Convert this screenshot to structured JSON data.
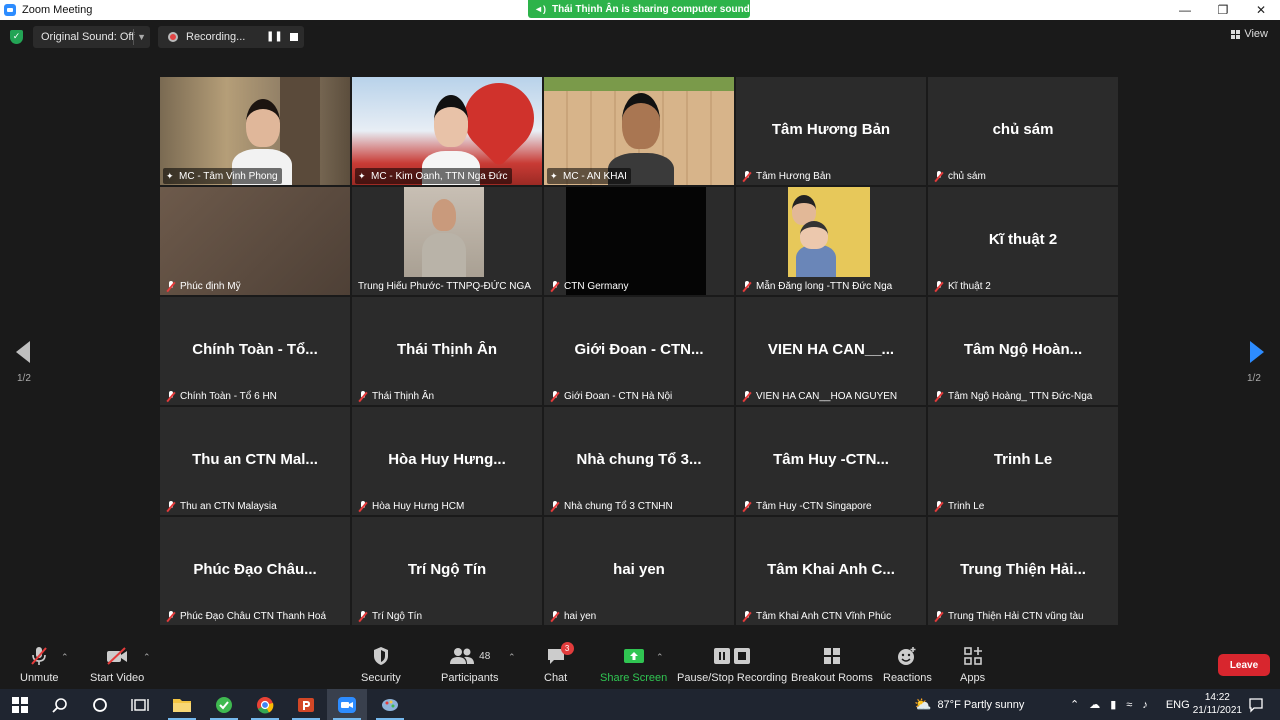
{
  "window": {
    "title": "Zoom Meeting"
  },
  "share_banner": {
    "text": "Thái Thịnh Ân is sharing computer sound"
  },
  "topbar": {
    "original_sound": "Original Sound: Off",
    "recording": "Recording...",
    "view": "View"
  },
  "pagination": {
    "left": "1/2",
    "right": "1/2"
  },
  "tiles": [
    {
      "name": "MC - Tâm Vinh Phong",
      "big": "",
      "video": true,
      "pinned": true
    },
    {
      "name": "MC - Kim Oanh, TTN Nga Đức",
      "big": "",
      "video": true,
      "pinned": true
    },
    {
      "name": "MC - AN KHAI",
      "big": "",
      "video": true,
      "pinned": true
    },
    {
      "name": "Tâm Hương Bản",
      "big": "Tâm Hương Bản",
      "video": false
    },
    {
      "name": "chủ sám",
      "big": "chủ sám",
      "video": false
    },
    {
      "name": "Phúc định Mỹ",
      "big": "",
      "video": true
    },
    {
      "name": "Trung Hiếu Phước- TTNPQ-ĐỨC NGA",
      "big": "",
      "video": true
    },
    {
      "name": "CTN Germany",
      "big": "",
      "video": true
    },
    {
      "name": "Mẫn Đăng long -TTN Đức Nga",
      "big": "",
      "video": true
    },
    {
      "name": "Kĩ thuật 2",
      "big": "Kĩ thuật 2",
      "video": false
    },
    {
      "name": "Chính Toàn - Tổ 6 HN",
      "big": "Chính Toàn - Tổ...",
      "video": false
    },
    {
      "name": "Thái Thịnh Ân",
      "big": "Thái Thịnh Ân",
      "video": false
    },
    {
      "name": "Giới Đoan - CTN Hà Nội",
      "big": "Giới Đoan - CTN...",
      "video": false
    },
    {
      "name": "VIEN HA CAN__HOA NGUYEN",
      "big": "VIEN HA CAN__...",
      "video": false
    },
    {
      "name": "Tâm Ngộ Hoàng_ TTN Đức-Nga",
      "big": "Tâm Ngộ Hoàn...",
      "video": false
    },
    {
      "name": "Thu an CTN Malaysia",
      "big": "Thu an CTN Mal...",
      "video": false
    },
    {
      "name": "Hòa Huy Hưng HCM",
      "big": "Hòa Huy Hưng...",
      "video": false
    },
    {
      "name": "Nhà chung Tổ 3 CTNHN",
      "big": "Nhà chung Tổ 3...",
      "video": false
    },
    {
      "name": "Tâm Huy -CTN Singapore",
      "big": "Tâm Huy -CTN...",
      "video": false
    },
    {
      "name": "Trinh Le",
      "big": "Trinh Le",
      "video": false
    },
    {
      "name": "Phúc Đạo Châu CTN Thanh Hoá",
      "big": "Phúc Đạo Châu...",
      "video": false
    },
    {
      "name": "Trí Ngộ Tín",
      "big": "Trí Ngộ Tín",
      "video": false
    },
    {
      "name": "hai yen",
      "big": "hai yen",
      "video": false
    },
    {
      "name": "Tâm Khai Anh CTN Vĩnh Phúc",
      "big": "Tâm Khai Anh C...",
      "video": false
    },
    {
      "name": "Trung Thiện Hải CTN vũng tàu",
      "big": "Trung Thiện Hải...",
      "video": false
    }
  ],
  "toolbar": {
    "unmute": "Unmute",
    "start_video": "Start Video",
    "security": "Security",
    "participants": "Participants",
    "participant_count": "48",
    "chat": "Chat",
    "chat_badge": "3",
    "share_screen": "Share Screen",
    "pause_recording": "Pause/Stop Recording",
    "breakout_rooms": "Breakout Rooms",
    "reactions": "Reactions",
    "apps": "Apps",
    "leave": "Leave"
  },
  "taskbar": {
    "weather": "87°F  Partly sunny",
    "language": "ENG",
    "time": "14:22",
    "date": "21/11/2021"
  },
  "colors": {
    "active_speaker": "#e9e35a",
    "share_green": "#2db34a",
    "leave_red": "#d8262e",
    "accent_blue": "#2d8cff"
  }
}
